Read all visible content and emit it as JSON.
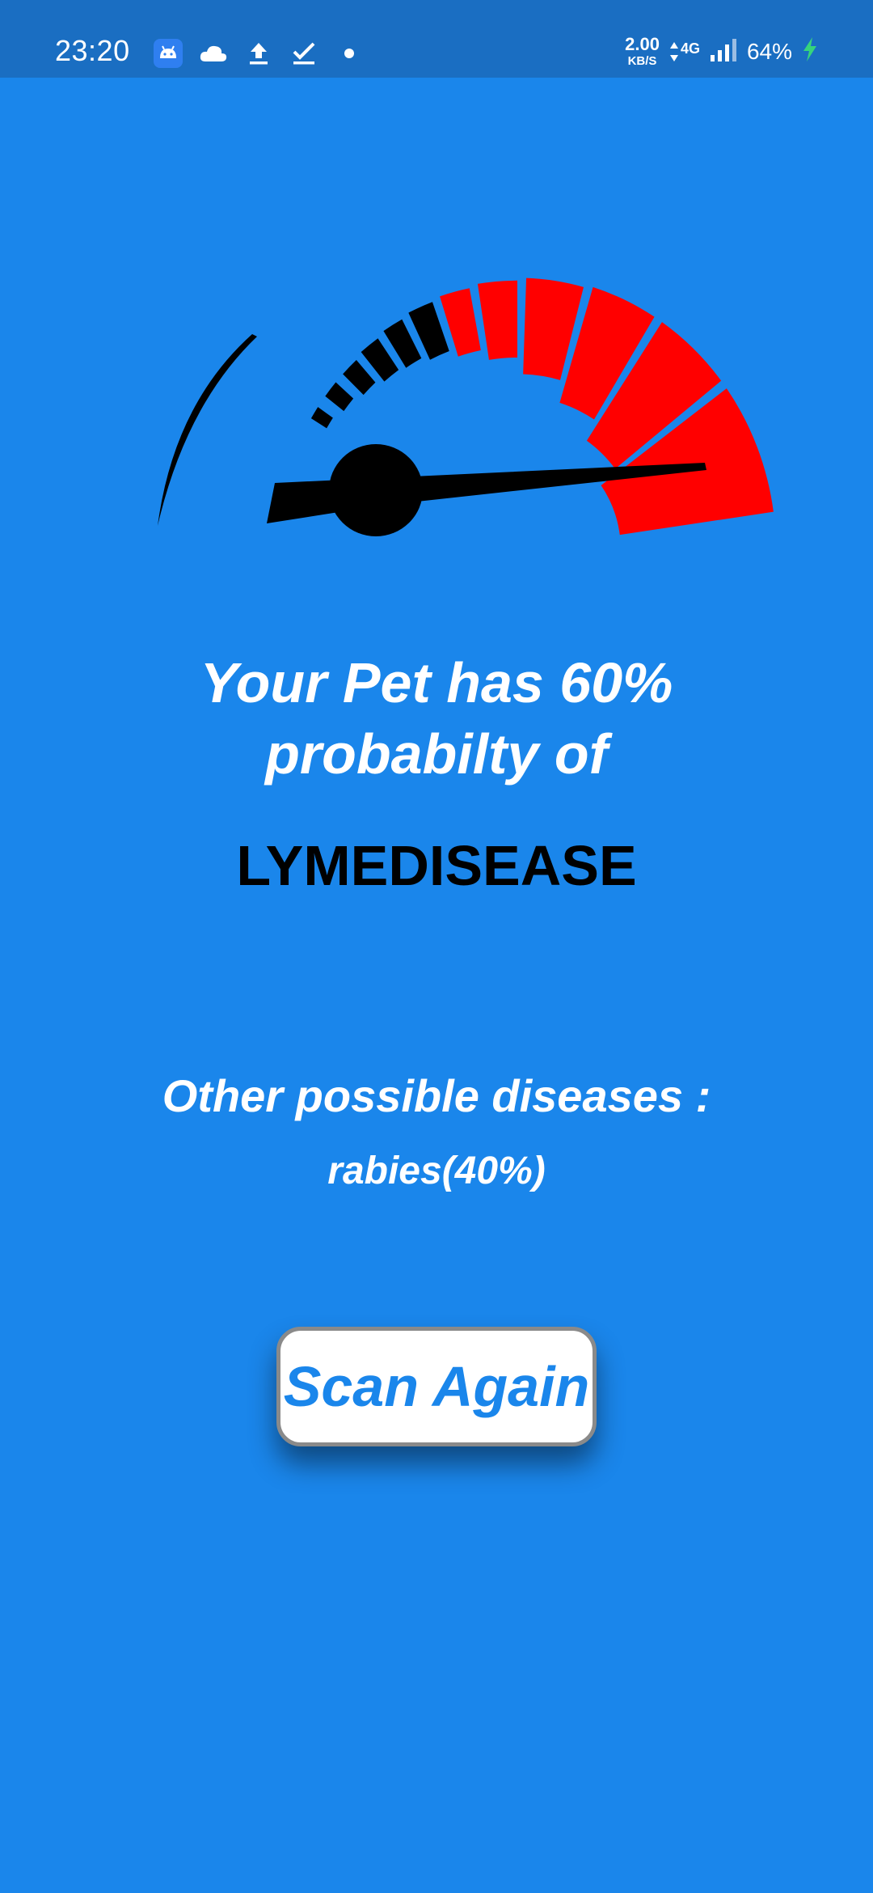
{
  "status_bar": {
    "time": "23:20",
    "net_speed_value": "2.00",
    "net_speed_unit": "KB/S",
    "network_type": "4G",
    "battery": "64%",
    "icons": [
      "android-icon",
      "cloud-icon",
      "upload-icon",
      "check-icon",
      "dot-icon",
      "data-arrows-icon",
      "signal-icon",
      "charging-icon"
    ]
  },
  "gauge": {
    "probability_percent": 60,
    "active_color": "#FF0000",
    "inactive_color": "#000000"
  },
  "result": {
    "headline_line1": "Your Pet has 60%",
    "headline_line2": "probabilty of",
    "disease_name": "LYMEDISEASE"
  },
  "other": {
    "label": "Other possible diseases :",
    "items": [
      "rabies(40%)"
    ]
  },
  "actions": {
    "scan_again_label": "Scan Again"
  },
  "colors": {
    "background": "#1A86EB",
    "status_bar": "#1A6EC2",
    "button_text": "#1A86EB"
  }
}
